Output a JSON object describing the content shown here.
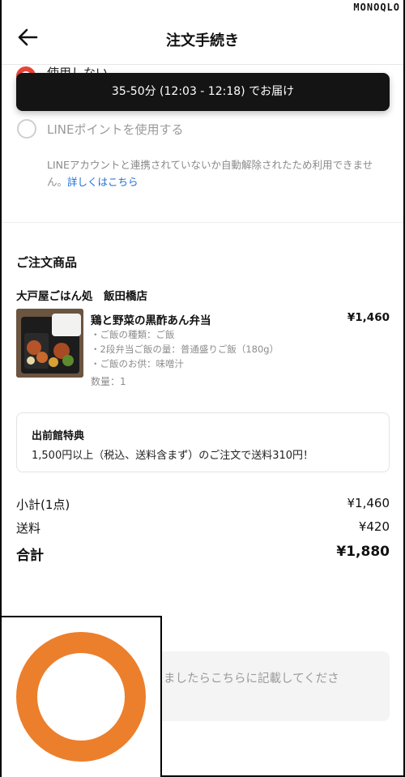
{
  "watermark": "MONOQLO",
  "header": {
    "title": "注文手続き"
  },
  "points": {
    "partial_label": "使用しない",
    "line_label": "LINEポイントを使用する",
    "line_note": "LINEアカウントと連携されていないか自動解除されたため利用できません。",
    "line_link": "詳しくはこちら"
  },
  "toast": {
    "text": "35-50分 (12:03 - 12:18) でお届け"
  },
  "order": {
    "section_title": "ご注文商品",
    "shop_name": "大戸屋ごはん処　飯田橋店",
    "item": {
      "name": "鶏と野菜の黒酢あん弁当",
      "price": "¥1,460",
      "options": [
        "・ご飯の種類：ご飯",
        "・2段弁当ご飯の量：普通盛りご飯（180g）",
        "・ご飯のお供：味噌汁"
      ],
      "quantity": "数量：1"
    }
  },
  "promo": {
    "title": "出前館特典",
    "text": "1,500円以上（税込、送料含まず）のご注文で送料310円！"
  },
  "summary": {
    "subtotal_label": "小計(1点)",
    "subtotal_value": "¥1,460",
    "shipping_label": "送料",
    "shipping_value": "¥420",
    "total_label": "合計",
    "total_value": "¥1,880"
  },
  "notes": {
    "placeholder_visible": "ましたらこちらに記載してくださ"
  },
  "colors": {
    "accent_red": "#e8453c",
    "link_blue": "#1f6fd6",
    "marker_orange": "#ec7f2c",
    "toast_bg": "#141414"
  },
  "icons": {
    "back": "arrow-left-icon"
  }
}
